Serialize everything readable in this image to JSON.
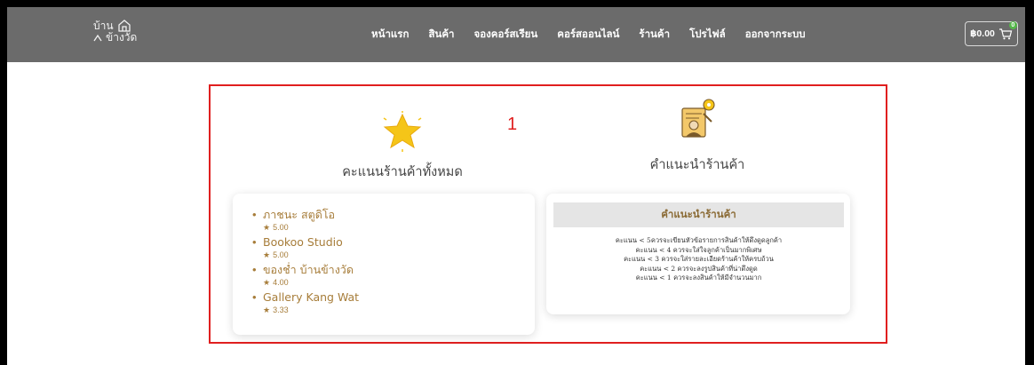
{
  "header": {
    "logo_line1": "บ้าน",
    "logo_line2": "ข้างวัด",
    "menu": [
      "หน้าแรก",
      "สินค้า",
      "จองคอร์สเรียน",
      "คอร์สออนไลน์",
      "ร้านค้า",
      "โปรไฟล์",
      "ออกจากระบบ"
    ],
    "cart_total": "฿0.00",
    "cart_count": "0"
  },
  "annotation": {
    "marker": "1"
  },
  "ratings_section": {
    "title": "คะแนนร้านค้าทั้งหมด",
    "icon": "star-icon",
    "shops": [
      {
        "name": "ภาชนะ สตูดิโอ",
        "rating": "5.00"
      },
      {
        "name": "Bookoo Studio",
        "rating": "5.00"
      },
      {
        "name": "ของช่ำ บ้านข้างวัด",
        "rating": "4.00"
      },
      {
        "name": "Gallery Kang Wat",
        "rating": "3.33"
      }
    ]
  },
  "advice_section": {
    "title": "คำแนะนำร้านค้า",
    "icon": "advisor-icon",
    "card_title": "คำแนะนำร้านค้า",
    "lines": [
      "คะแนน < 5ควรจะเขียนหัวข้อรายการสินค้าให้ดึงดูดลูกค้า",
      "คะแนน < 4 ควรจะใส่ใจลูกค้าเป็นมากพิเศษ",
      "คะแนน < 3 ควรจะใส่รายละเอียดร้านค้าให้ครบถ้วน",
      "คะแนน < 2 ควรจะลงรูปสินค้าที่น่าดึงดูด",
      "คะแนน < 1 ควรจะลงสินค้าให้มีจำนวนมาก"
    ]
  },
  "colors": {
    "navbar": "#6b6b6b",
    "accent": "#a77d3a",
    "highlight": "#e01f1f",
    "star": "#f5c518"
  }
}
